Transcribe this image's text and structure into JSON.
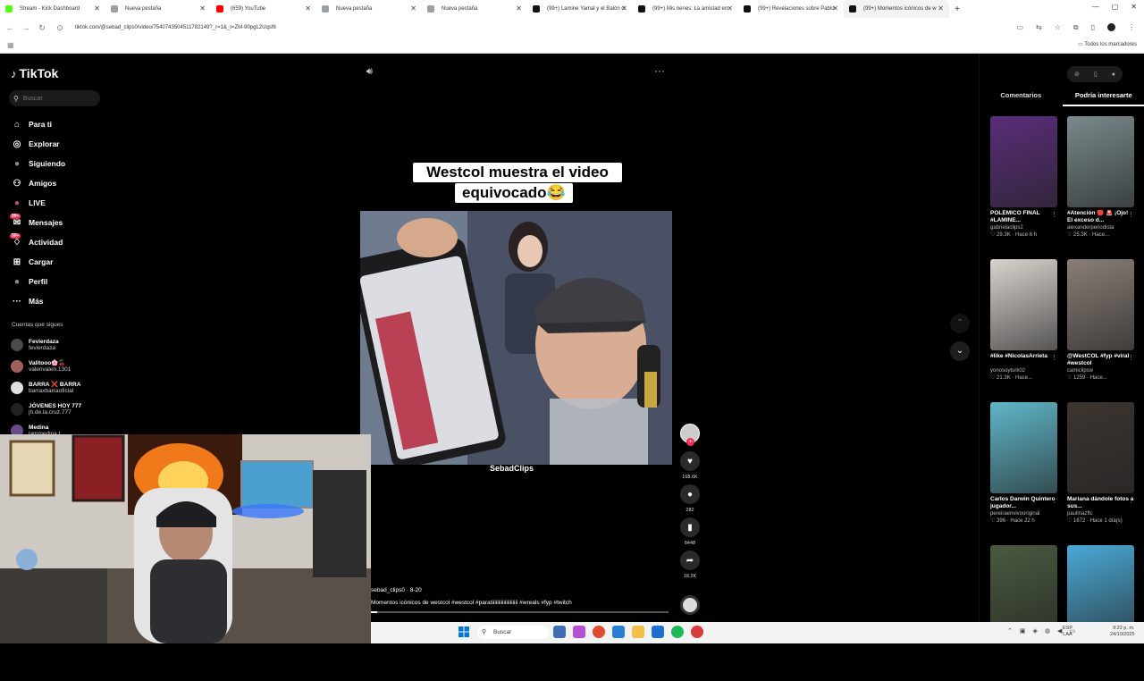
{
  "browser": {
    "tabs": [
      {
        "title": "Stream - Kick Dashboard",
        "color": "#53fc18"
      },
      {
        "title": "Nueva pestaña",
        "color": "#9aa0a6"
      },
      {
        "title": "(659) YouTube",
        "color": "#ff0000"
      },
      {
        "title": "Nueva pestaña",
        "color": "#9aa0a6"
      },
      {
        "title": "Nueva pestaña",
        "color": "#9aa0a6"
      },
      {
        "title": "(99+) Lamine Yamal y el Balón d",
        "color": "#111111"
      },
      {
        "title": "(99+) Mis nenes: La amistad en",
        "color": "#111111"
      },
      {
        "title": "(99+) Revelaciones sobre Pablo",
        "color": "#111111"
      },
      {
        "title": "(99+) Momentos icónicos de w",
        "color": "#111111"
      }
    ],
    "url": "tiktok.com/@sebad_clips0/video/7540743504511782149?_r=1&_t=ZM-90pgL2Uqsf6",
    "bookmarks_all": "Todos los marcadores"
  },
  "tiktok": {
    "logo": "TikTok",
    "search_placeholder": "Buscar",
    "nav": [
      {
        "label": "Para ti",
        "icon": "home-icon",
        "glyph": "⌂"
      },
      {
        "label": "Explorar",
        "icon": "compass-icon",
        "glyph": "◎"
      },
      {
        "label": "Siguiendo",
        "icon": "following-avatar-icon",
        "glyph": "●"
      },
      {
        "label": "Amigos",
        "icon": "friends-icon",
        "glyph": "⚇"
      },
      {
        "label": "LIVE",
        "icon": "live-avatar-icon",
        "glyph": "●"
      },
      {
        "label": "Mensajes",
        "icon": "messages-icon",
        "glyph": "✉",
        "badge": "99+"
      },
      {
        "label": "Actividad",
        "icon": "activity-icon",
        "glyph": "♢",
        "badge": "99+"
      },
      {
        "label": "Cargar",
        "icon": "upload-icon",
        "glyph": "⊞"
      },
      {
        "label": "Perfil",
        "icon": "profile-avatar-icon",
        "glyph": "●"
      },
      {
        "label": "Más",
        "icon": "more-dots-icon",
        "glyph": "···"
      }
    ],
    "following_title": "Cuentas que sigues",
    "following": [
      {
        "name": "Fevierdaza",
        "handle": "fevierdaza"
      },
      {
        "name": "Valitooo🌸🍒",
        "handle": "valenvalen.1301"
      },
      {
        "name": "BARRA ❌ BARRA",
        "handle": "barraxbarraoficial"
      },
      {
        "name": "JÓVENES HOY 777",
        "handle": "jh.de.la.cruz.777"
      },
      {
        "name": "Medina",
        "handle": "lammedina.t"
      }
    ]
  },
  "video": {
    "caption_line1": "Westcol muestra el video",
    "caption_line2": "equivocado😂",
    "watermark": "SebadClips",
    "author": "sebad_clips0 · 8-20",
    "description": "Momentos icónicos de westcol #westcol #paratiiiiiiiiiiiiiiiiiiii #wreals #fyp #twitch",
    "progress": 0.02,
    "likes": "168.6K",
    "comments": "282",
    "saves": "8448",
    "shares": "18.2K"
  },
  "panel": {
    "tabs": [
      "Comentarios",
      "Podría interesarte"
    ],
    "active_tab": 1,
    "cards": [
      {
        "title": "POLÉMICO FINAL #LAMINE...",
        "user": "gabrielaclips2",
        "meta": "♡ 29.3K · Hace 6 h",
        "color": "#5a2d7a"
      },
      {
        "title": "#Atención 🔴 🚨 ¡Ojo! El exceso d...",
        "user": "alexanderperiodista",
        "meta": "♡ 25.3K · Hace...",
        "color": "#7a8a8c"
      },
      {
        "title": "#like #NicolasArrieta",
        "user": "yonosoyturk02",
        "meta": "♡ 21.3K · Hace...",
        "color": "#d9d4cf"
      },
      {
        "title": "@WestCOL #fyp #viral #westcol",
        "user": "camiclipsw",
        "meta": "♡ 1259 · Hace...",
        "color": "#8a7f78"
      },
      {
        "title": "Carlos Darwin Quintero jugador...",
        "user": "pereiraenvivooriginal",
        "meta": "♡ 396 · Hace 22 h",
        "color": "#5fb7c9"
      },
      {
        "title": "Mariana dándole fotos a sus...",
        "user": "paulinazftc",
        "meta": "♡ 1672 · Hace 1 día(s)",
        "color": "#3c3530"
      },
      {
        "title": "",
        "user": "",
        "meta": "",
        "color": "#4a5a3f"
      },
      {
        "title": "",
        "user": "",
        "meta": "",
        "color": "#4aa9d6"
      }
    ]
  },
  "taskbar": {
    "search": "Buscar",
    "lang_line1": "ESP",
    "lang_line2": "LAA",
    "time": "9:22 p. m.",
    "date": "24/10/2025"
  },
  "colors": {
    "accent": "#fe2c55",
    "background": "#000000"
  }
}
